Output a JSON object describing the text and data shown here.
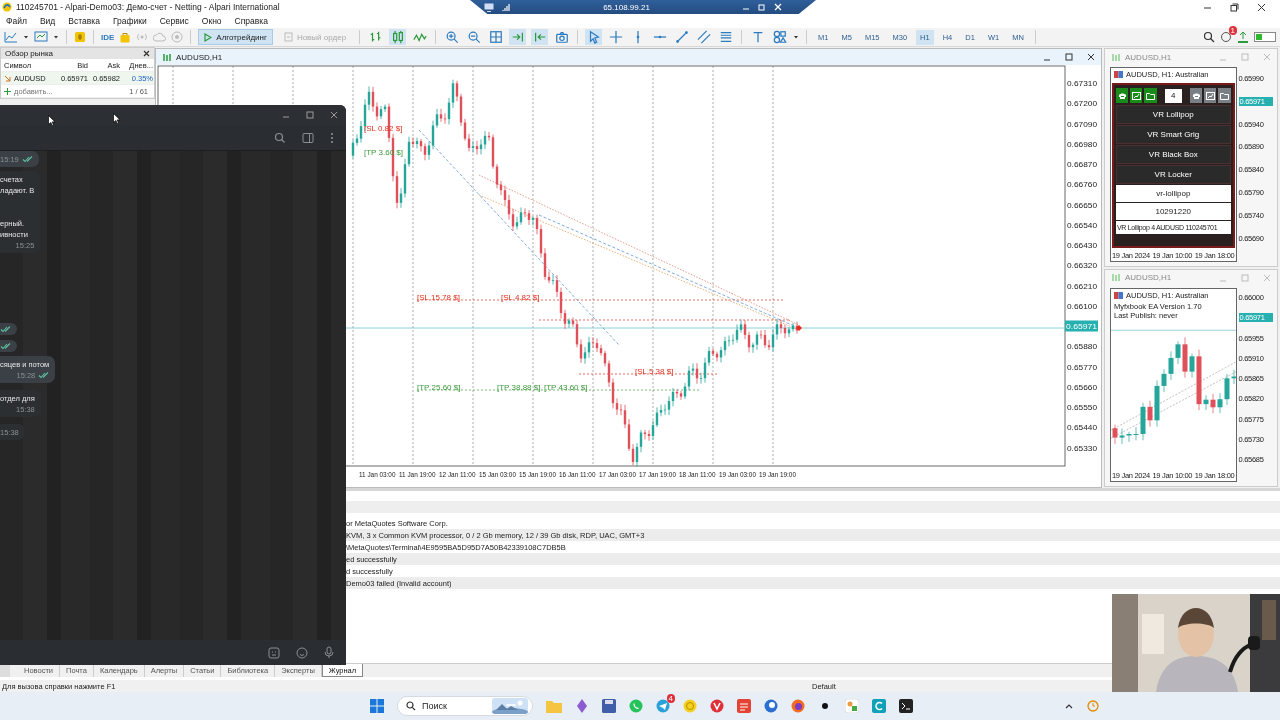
{
  "window": {
    "title": "110245701 - Alpari-Demo03: Демо-счет - Netting - Alpari International"
  },
  "remote_bar": {
    "address": "65.108.99.21"
  },
  "menu": [
    "Файл",
    "Вид",
    "Вставка",
    "Графики",
    "Сервис",
    "Окно",
    "Справка"
  ],
  "toolbar": {
    "ide_label": "IDE",
    "buttons": [
      {
        "label": "Алготрейдинг",
        "selected": true,
        "disabled": false
      },
      {
        "label": "Новый ордер",
        "selected": false,
        "disabled": true
      }
    ],
    "tools": [
      {
        "kind": "bars",
        "selected": false
      },
      {
        "kind": "candles",
        "selected": true
      },
      {
        "kind": "line",
        "selected": false
      },
      {
        "kind": "zoom-in",
        "selected": false
      },
      {
        "kind": "zoom-out",
        "selected": false
      },
      {
        "kind": "grid",
        "selected": false
      },
      {
        "kind": "autoscroll",
        "selected": true
      },
      {
        "kind": "shift",
        "selected": true
      },
      {
        "kind": "screenshot",
        "selected": false
      },
      {
        "kind": "cursor",
        "selected": true
      },
      {
        "kind": "crosshair",
        "selected": false
      },
      {
        "kind": "vline",
        "selected": false
      },
      {
        "kind": "hline",
        "selected": false
      },
      {
        "kind": "trend",
        "selected": false
      },
      {
        "kind": "channel",
        "selected": false
      },
      {
        "kind": "fibo",
        "selected": false
      },
      {
        "kind": "text",
        "selected": false
      },
      {
        "kind": "shapes",
        "selected": false
      }
    ],
    "timeframes": [
      {
        "label": "M1",
        "selected": false
      },
      {
        "label": "M5",
        "selected": false
      },
      {
        "label": "M15",
        "selected": false
      },
      {
        "label": "M30",
        "selected": false
      },
      {
        "label": "H1",
        "selected": true
      },
      {
        "label": "H4",
        "selected": false
      },
      {
        "label": "D1",
        "selected": false
      },
      {
        "label": "W1",
        "selected": false
      },
      {
        "label": "MN",
        "selected": false
      }
    ],
    "notification_count": "1"
  },
  "market_watch": {
    "title": "Обзор рынка",
    "columns": [
      "Символ",
      "Bid",
      "Ask",
      "Днев..."
    ],
    "rows": [
      {
        "symbol": "AUDUSD",
        "bid": "0.65971",
        "ask": "0.65982",
        "change": "0.35%"
      }
    ],
    "add_label": "добавить...",
    "count": "1 / 61"
  },
  "main_chart": {
    "title": "AUDUSD,H1",
    "price_axis": [
      {
        "text": "0.67310"
      },
      {
        "text": "0.67200"
      },
      {
        "text": "0.67090"
      },
      {
        "text": "0.66980"
      },
      {
        "text": "0.66870"
      },
      {
        "text": "0.66760"
      },
      {
        "text": "0.66650"
      },
      {
        "text": "0.66540"
      },
      {
        "text": "0.66430"
      },
      {
        "text": "0.66320"
      },
      {
        "text": "0.66210"
      },
      {
        "text": "0.66100"
      },
      {
        "text": "0.65971",
        "kind": "tag"
      },
      {
        "text": "0.65880"
      },
      {
        "text": "0.65770"
      },
      {
        "text": "0.65660"
      },
      {
        "text": "0.65550"
      },
      {
        "text": "0.65440"
      },
      {
        "text": "0.65330"
      }
    ],
    "time_axis": [
      "11 Jan 03:00",
      "11 Jan 19:00",
      "12 Jan 11:00",
      "15 Jan 03:00",
      "15 Jan 19:00",
      "16 Jan 11:00",
      "17 Jan 03:00",
      "17 Jan 19:00",
      "18 Jan 11:00",
      "19 Jan 03:00",
      "19 Jan 19:00"
    ],
    "trade_labels": [
      {
        "text": "[SL 0.82 $]",
        "kind": "sl"
      },
      {
        "text": "[TP 3.60 $]",
        "kind": "tp"
      },
      {
        "text": "[SL 15.78 $]",
        "kind": "sl"
      },
      {
        "text": "[SL 4.82 $]",
        "kind": "sl"
      },
      {
        "text": "[SL 5.38 $]",
        "kind": "sl"
      },
      {
        "text": "[TP 25.60 $]",
        "kind": "tp"
      },
      {
        "text": "[TP 38.88 $]",
        "kind": "tp"
      },
      {
        "text": "[TP 43.60 $]",
        "kind": "tp"
      }
    ]
  },
  "vr_chart": {
    "title": "AUDUSD,H1",
    "header": "AUDUSD, H1: Australian",
    "lot_field": "4",
    "buttons": [
      "VR Lollipop",
      "VR Smart Grig",
      "VR Black Box",
      "VR Locker"
    ],
    "fields": [
      "vr-lollipop",
      "10291220"
    ],
    "info": "VR Lollipop 4 AUDUSD 110245701",
    "price_axis": [
      {
        "text": "0.65990"
      },
      {
        "text": "0.65971",
        "kind": "tag"
      },
      {
        "text": "0.65940"
      },
      {
        "text": "0.65890"
      },
      {
        "text": "0.65840"
      },
      {
        "text": "0.65790"
      },
      {
        "text": "0.65740"
      },
      {
        "text": "0.65690"
      }
    ],
    "time_axis": [
      "19 Jan 2024",
      "19 Jan 10:00",
      "19 Jan 18:00"
    ]
  },
  "myfxbook_chart": {
    "title": "AUDUSD,H1",
    "header": "AUDUSD, H1: Australian",
    "lines": [
      "Myfxbook EA Version 1.70",
      "Last Publish: never"
    ],
    "price_axis": [
      {
        "text": "0.66000"
      },
      {
        "text": "0.65971",
        "kind": "tag"
      },
      {
        "text": "0.65955"
      },
      {
        "text": "0.65910"
      },
      {
        "text": "0.65865"
      },
      {
        "text": "0.65820"
      },
      {
        "text": "0.65775"
      },
      {
        "text": "0.65730"
      },
      {
        "text": "0.65685"
      }
    ],
    "time_axis": [
      "19 Jan 2024",
      "19 Jan 10:00",
      "19 Jan 18:00"
    ]
  },
  "journal": {
    "rows": [
      "or MetaQuotes Software Corp.",
      "KVM, 3 x Common KVM processor, 0 / 2 Gb memory, 12 / 39 Gb disk, RDP, UAC, GMT+3",
      "\\MetaQuotes\\Terminal\\4E9595BA5D95D7A50B42339108C7DB5B",
      "ed successfully",
      "d successfully",
      "Demo03 failed (Invalid account)"
    ],
    "tabs": [
      {
        "label": "Новости",
        "selected": false
      },
      {
        "label": "Почта",
        "selected": false
      },
      {
        "label": "Календарь",
        "selected": false
      },
      {
        "label": "Алерты",
        "selected": false
      },
      {
        "label": "Статьи",
        "selected": false
      },
      {
        "label": "Библиотека",
        "selected": false
      },
      {
        "label": "Эксперты",
        "selected": false
      },
      {
        "label": "Журнал",
        "selected": true
      }
    ]
  },
  "status_bar": {
    "hint": "Для вызова справки нажмите F1",
    "profile": "Default"
  },
  "messenger": {
    "messages": [
      {
        "kind": "outgoing",
        "time": "15:19",
        "read": true
      },
      {
        "kind": "incoming",
        "paragraphs": [
          [
            "счетах",
            "ладают. В"
          ],
          [
            "ерный.",
            "ивности"
          ]
        ],
        "time": "15:25",
        "read": false
      },
      {
        "kind": "outgoing",
        "read": true
      },
      {
        "kind": "outgoing",
        "read": true
      },
      {
        "kind": "outgoing",
        "paragraphs": [
          [
            "сяцев и потом"
          ]
        ],
        "time": "15:28",
        "read": true
      },
      {
        "kind": "incoming",
        "paragraphs": [
          [
            "отдел для"
          ]
        ],
        "time": "15:38",
        "read": false
      },
      {
        "kind": "incoming",
        "time": "15:38",
        "read": false
      }
    ]
  },
  "taskbar": {
    "search": {
      "placeholder": "Поиск"
    },
    "badge": "4"
  },
  "webcam": {
    "kind": "picture"
  }
}
